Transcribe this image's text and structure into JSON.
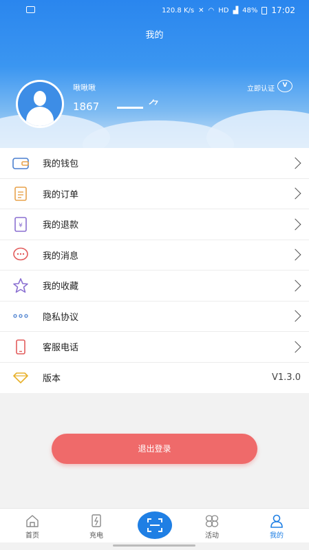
{
  "status_bar": {
    "network_speed": "120.8 K/s",
    "signal_label": "HD",
    "battery": "48%",
    "time": "17:02"
  },
  "page": {
    "title": "我的"
  },
  "profile": {
    "username": "啾啾啾",
    "phone": "1867",
    "verify_label": "立即认证",
    "verify_badge": "V"
  },
  "menu": [
    {
      "label": "我的钱包",
      "icon": "wallet-icon"
    },
    {
      "label": "我的订单",
      "icon": "order-icon"
    },
    {
      "label": "我的退款",
      "icon": "refund-icon"
    },
    {
      "label": "我的消息",
      "icon": "message-icon"
    },
    {
      "label": "我的收藏",
      "icon": "star-icon"
    },
    {
      "label": "隐私协议",
      "icon": "dots-icon"
    },
    {
      "label": "客服电话",
      "icon": "phone-icon"
    },
    {
      "label": "版本",
      "icon": "diamond-icon",
      "value": "V1.3.0"
    }
  ],
  "logout": {
    "label": "退出登录"
  },
  "tabbar": {
    "items": [
      {
        "label": "首页",
        "icon": "home-icon"
      },
      {
        "label": "充电",
        "icon": "charge-icon"
      },
      {
        "label": "",
        "icon": "scan-icon"
      },
      {
        "label": "活动",
        "icon": "activity-icon"
      },
      {
        "label": "我的",
        "icon": "profile-icon"
      }
    ],
    "active": "我的"
  },
  "colors": {
    "header_top": "#2a86ee",
    "accent_blue": "#1f7fe4",
    "logout_red": "#ef6a6a",
    "icon_orange": "#e8a24a",
    "icon_red": "#e25c5c",
    "icon_purple": "#8a6fd1",
    "icon_blue": "#4a7fcf"
  }
}
